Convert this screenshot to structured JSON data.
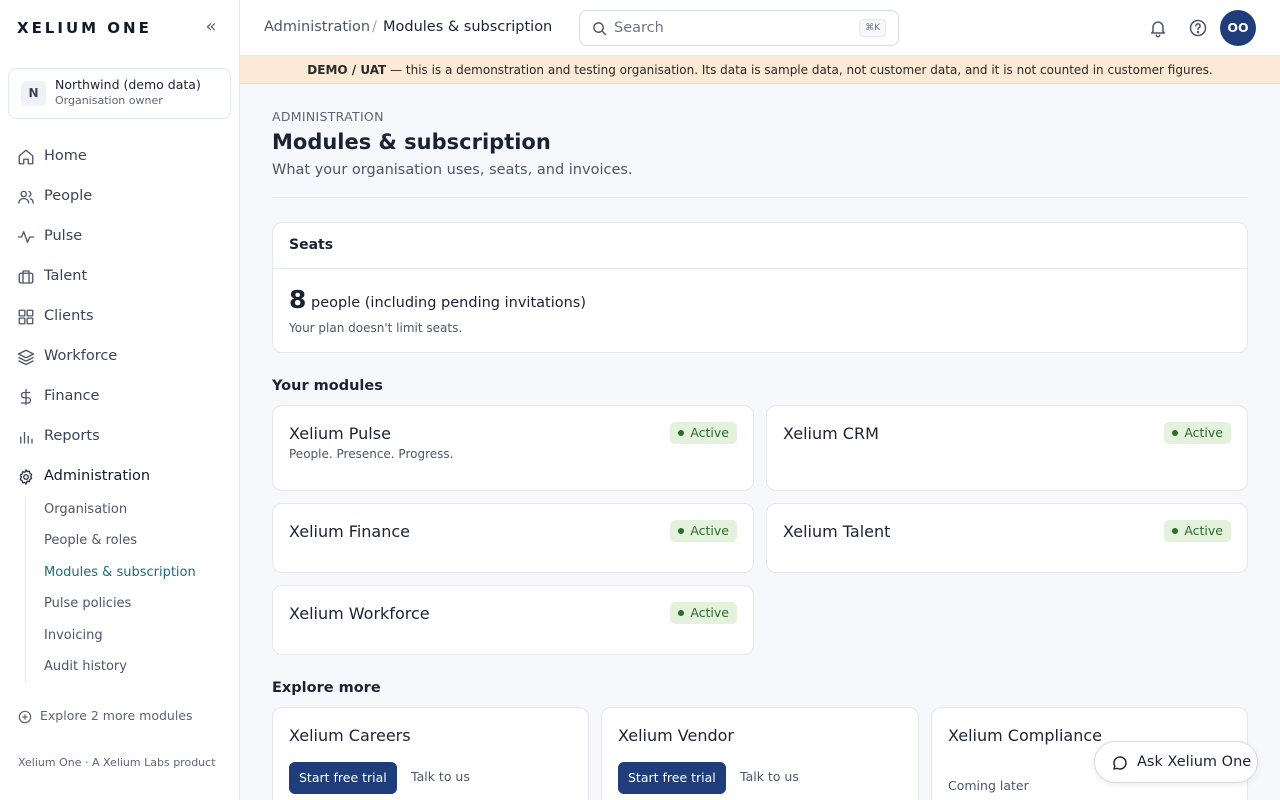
{
  "app": {
    "brand": "XELIUM ONE",
    "collapse_glyph": "«"
  },
  "org": {
    "initial": "N",
    "name": "Northwind (demo data)",
    "role": "Organisation owner"
  },
  "nav": [
    {
      "label": "Home",
      "icon": "home-icon"
    },
    {
      "label": "People",
      "icon": "people-icon"
    },
    {
      "label": "Pulse",
      "icon": "pulse-icon"
    },
    {
      "label": "Talent",
      "icon": "briefcase-icon"
    },
    {
      "label": "Clients",
      "icon": "grid-icon"
    },
    {
      "label": "Workforce",
      "icon": "layers-icon"
    },
    {
      "label": "Finance",
      "icon": "dollar-icon"
    },
    {
      "label": "Reports",
      "icon": "bar-chart-icon"
    },
    {
      "label": "Administration",
      "icon": "gear-icon",
      "active": true
    }
  ],
  "subnav": [
    {
      "label": "Organisation"
    },
    {
      "label": "People & roles"
    },
    {
      "label": "Modules & subscription",
      "active": true
    },
    {
      "label": "Pulse policies"
    },
    {
      "label": "Invoicing"
    },
    {
      "label": "Audit history"
    }
  ],
  "sidebar_footer": {
    "explore": "Explore 2 more modules",
    "note": "Xelium One · A Xelium Labs product"
  },
  "topbar": {
    "breadcrumb": [
      "Administration",
      "Modules & subscription"
    ],
    "breadcrumb_sep": "/",
    "search_placeholder": "Search",
    "search_shortcut": "⌘K",
    "avatar_initials": "OO"
  },
  "banner": {
    "strong": "DEMO / UAT",
    "text": " — this is a demonstration and testing organisation. Its data is sample data, not customer data, and it is not counted in customer figures."
  },
  "page": {
    "eyebrow": "ADMINISTRATION",
    "title": "Modules & subscription",
    "subtitle": "What your organisation uses, seats, and invoices."
  },
  "seats": {
    "title": "Seats",
    "count": "8",
    "count_label": "people (including pending invitations)",
    "note": "Your plan doesn't limit seats."
  },
  "modules": {
    "heading": "Your modules",
    "items": [
      {
        "name": "Xelium Pulse",
        "tagline": "People. Presence. Progress.",
        "status": "Active"
      },
      {
        "name": "Xelium CRM",
        "tagline": "",
        "status": "Active"
      },
      {
        "name": "Xelium Finance",
        "tagline": "",
        "status": "Active"
      },
      {
        "name": "Xelium Talent",
        "tagline": "",
        "status": "Active"
      },
      {
        "name": "Xelium Workforce",
        "tagline": "",
        "status": "Active"
      }
    ]
  },
  "explore": {
    "heading": "Explore more",
    "items": [
      {
        "name": "Xelium Careers",
        "trial": "Start free trial",
        "talk": "Talk to us"
      },
      {
        "name": "Xelium Vendor",
        "trial": "Start free trial",
        "talk": "Talk to us"
      },
      {
        "name": "Xelium Compliance",
        "coming": "Coming later"
      }
    ]
  },
  "assistant": {
    "label": "Ask Xelium One"
  },
  "colors": {
    "primary": "#1f3d7a",
    "accent_link": "#1f6b7a",
    "banner_bg": "#fbebd6",
    "badge_bg": "#e3f1dd",
    "badge_fg": "#2d6a2a"
  }
}
